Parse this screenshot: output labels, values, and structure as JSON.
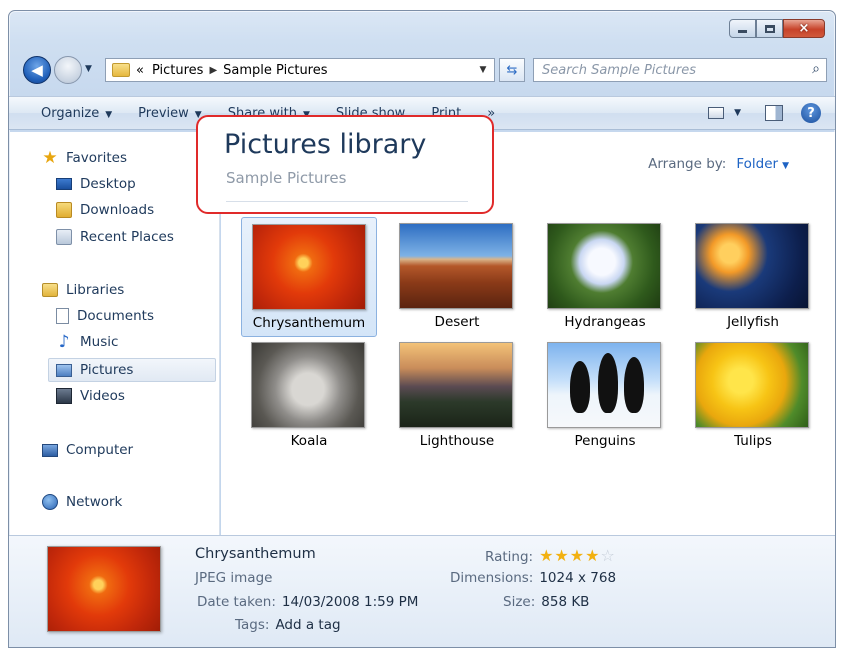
{
  "window": {
    "caption_buttons": {
      "minimize": "minimize",
      "maximize": "maximize",
      "close": "×"
    }
  },
  "nav": {
    "breadcrumb_root_sep": "«",
    "breadcrumb": [
      "Pictures",
      "Sample Pictures"
    ],
    "search_placeholder": "Search Sample Pictures"
  },
  "toolbar": {
    "items": [
      "Organize",
      "Preview",
      "Share with",
      "Slide show",
      "Print",
      "»"
    ]
  },
  "sidebar": {
    "favorites": "Favorites",
    "desktop": "Desktop",
    "downloads": "Downloads",
    "recent_places": "Recent Places",
    "libraries": "Libraries",
    "documents": "Documents",
    "music": "Music",
    "pictures": "Pictures",
    "videos": "Videos",
    "computer": "Computer",
    "network": "Network"
  },
  "content": {
    "library_title": "Pictures library",
    "library_subtitle": "Sample Pictures",
    "arrange_label": "Arrange by:",
    "arrange_value": "Folder",
    "thumbnails": [
      {
        "name": "Chrysanthemum",
        "selected": true
      },
      {
        "name": "Desert"
      },
      {
        "name": "Hydrangeas"
      },
      {
        "name": "Jellyfish"
      },
      {
        "name": "Koala"
      },
      {
        "name": "Lighthouse"
      },
      {
        "name": "Penguins"
      },
      {
        "name": "Tulips"
      }
    ]
  },
  "details": {
    "name": "Chrysanthemum",
    "type": "JPEG image",
    "date_label": "Date taken:",
    "date_value": "14/03/2008 1:59 PM",
    "tags_label": "Tags:",
    "tags_value": "Add a tag",
    "rating_label": "Rating:",
    "rating_value": 4,
    "rating_max": 5,
    "dimensions_label": "Dimensions:",
    "dimensions_value": "1024 x 768",
    "size_label": "Size:",
    "size_value": "858 KB"
  },
  "colors": {
    "accent": "#1e63c4",
    "highlight_border": "#e02a2a",
    "star": "#f2b111"
  }
}
